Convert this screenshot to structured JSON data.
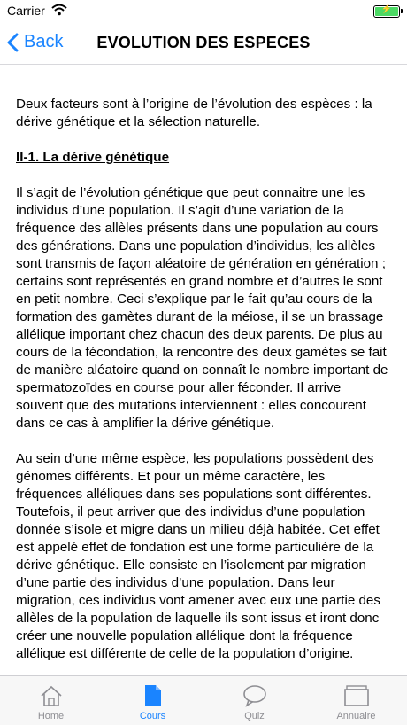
{
  "status": {
    "carrier": "Carrier"
  },
  "nav": {
    "back_label": "Back",
    "title": "EVOLUTION DES ESPECES"
  },
  "content": {
    "intro": "Deux facteurs sont à l’origine de l’évolution des espèces : la dérive génétique et la sélection naturelle.",
    "heading": "II-1. La dérive génétique",
    "para1": "Il s’agit de l’évolution génétique que peut connaitre une les individus d’une population. Il s’agit d’une variation de la fréquence des allèles présents dans une population au cours des générations. Dans une population d’individus, les allèles sont transmis de façon aléatoire de génération en génération ; certains sont représentés en grand nombre et d’autres le sont en petit nombre. Ceci s’explique par le fait qu’au cours de la formation des gamètes durant de la méiose, il se un brassage allélique important chez chacun des deux parents. De plus au cours de la fécondation, la rencontre des deux gamètes se fait de manière aléatoire quand on connaît le nombre important de spermatozoïdes en course pour aller féconder. Il arrive souvent que des mutations interviennent : elles concourent dans ce cas à amplifier la dérive génétique.",
    "para2": "Au sein d’une même espèce, les populations possèdent des génomes différents. Et pour un même caractère, les fréquences alléliques dans ses populations sont différentes. Toutefois, il peut arriver que des individus d’une population donnée s’isole et migre dans un milieu déjà habitée. Cet effet est appelé effet de fondation est une forme particulière de la dérive génétique. Elle consiste en l’isolement par migration d’une partie des individus d’une population. Dans leur migration, ces individus vont amener avec eux une partie des allèles de la population de laquelle ils sont issus et iront donc créer une nouvelle population allélique dont la fréquence allélique est différente de celle de la population d’origine."
  },
  "tabs": [
    {
      "label": "Home",
      "icon": "home-icon",
      "active": false
    },
    {
      "label": "Cours",
      "icon": "document-icon",
      "active": true
    },
    {
      "label": "Quiz",
      "icon": "chat-bubble-icon",
      "active": false
    },
    {
      "label": "Annuaire",
      "icon": "folder-icon",
      "active": false
    }
  ],
  "colors": {
    "accent": "#1a84ff",
    "inactive": "#8e8e93",
    "battery": "#4cd964"
  }
}
